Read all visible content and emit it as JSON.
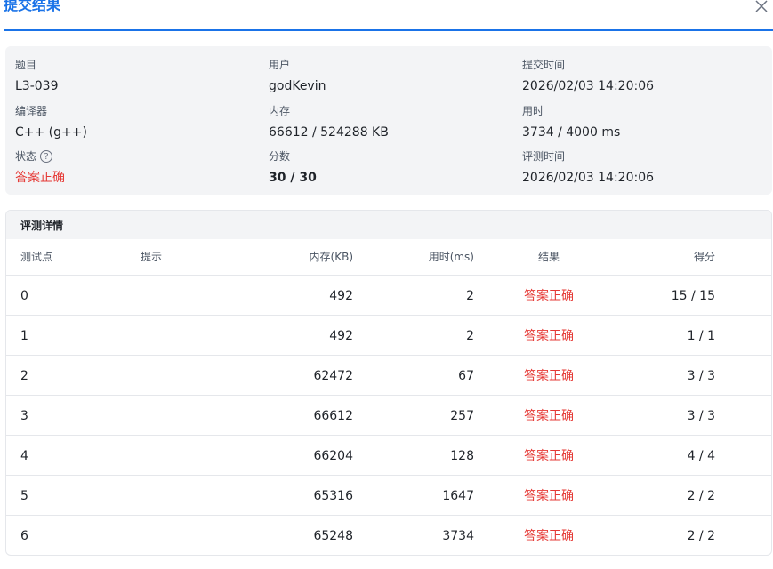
{
  "dialog": {
    "title": "提交结果"
  },
  "info": {
    "problem_label": "题目",
    "problem_value": "L3-039",
    "user_label": "用户",
    "user_value": "godKevin",
    "submit_time_label": "提交时间",
    "submit_time_value": "2026/02/03 14:20:06",
    "compiler_label": "编译器",
    "compiler_value": "C++ (g++)",
    "memory_label": "内存",
    "memory_value": "66612 / 524288 KB",
    "time_label": "用时",
    "time_value": "3734 / 4000 ms",
    "status_label": "状态",
    "status_help": "?",
    "status_value": "答案正确",
    "score_label": "分数",
    "score_value": "30 / 30",
    "judge_time_label": "评测时间",
    "judge_time_value": "2026/02/03 14:20:06"
  },
  "details": {
    "title": "评测详情",
    "columns": {
      "case": "测试点",
      "hint": "提示",
      "memory": "内存(KB)",
      "time": "用时(ms)",
      "result": "结果",
      "score": "得分"
    },
    "rows": [
      {
        "case": "0",
        "hint": "",
        "memory": "492",
        "time": "2",
        "result": "答案正确",
        "score": "15 / 15"
      },
      {
        "case": "1",
        "hint": "",
        "memory": "492",
        "time": "2",
        "result": "答案正确",
        "score": "1 / 1"
      },
      {
        "case": "2",
        "hint": "",
        "memory": "62472",
        "time": "67",
        "result": "答案正确",
        "score": "3 / 3"
      },
      {
        "case": "3",
        "hint": "",
        "memory": "66612",
        "time": "257",
        "result": "答案正确",
        "score": "3 / 3"
      },
      {
        "case": "4",
        "hint": "",
        "memory": "66204",
        "time": "128",
        "result": "答案正确",
        "score": "4 / 4"
      },
      {
        "case": "5",
        "hint": "",
        "memory": "65316",
        "time": "1647",
        "result": "答案正确",
        "score": "2 / 2"
      },
      {
        "case": "6",
        "hint": "",
        "memory": "65248",
        "time": "3734",
        "result": "答案正确",
        "score": "2 / 2"
      }
    ]
  },
  "colors": {
    "accent": "#1a73e8",
    "accepted": "#e53935"
  }
}
